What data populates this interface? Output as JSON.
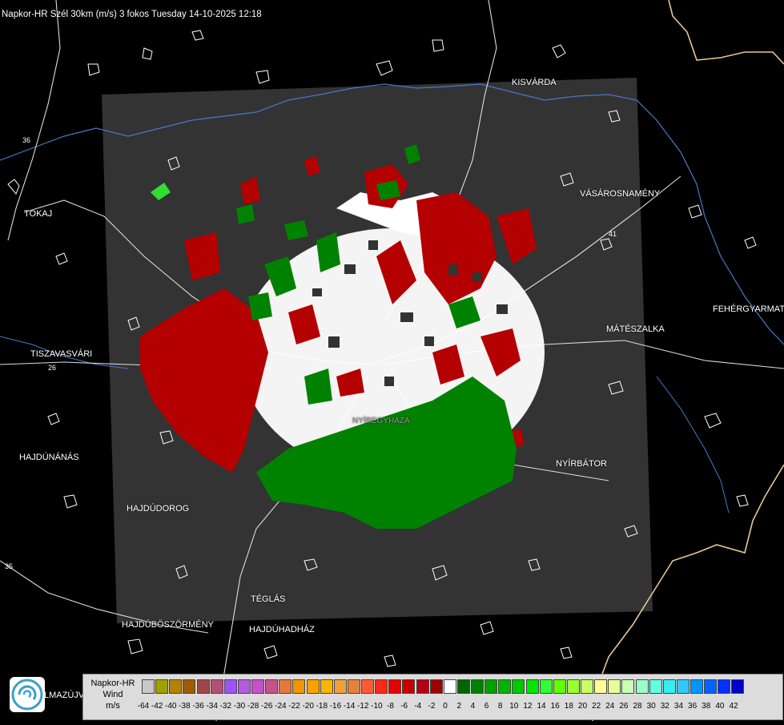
{
  "title": "Napkor-HR Szél 30km (m/s) 3 fokos Tuesday 14-10-2025 12:18",
  "towns": {
    "kisvarda": "KISVÁRDA",
    "vasarosnameny": "VÁSÁROSNAMÉNY",
    "tokaj": "TOKAJ",
    "fehergyarmat": "FEHÉRGYARMAT",
    "mateszalka": "MÁTÉSZALKA",
    "tiszavasvari": "TISZAVASVÁRI",
    "hajdunanas": "HAJDÚNÁNÁS",
    "nyirbator": "NYÍRBÁTOR",
    "hajdudorog": "HAJDÚDOROG",
    "teglas": "TÉGLÁS",
    "hajduboszormeny": "HAJDÚBÖSZÖRMÉNY",
    "hajduhadhaz": "HAJDÚHADHÁZ",
    "nyiregyhaza": "NYÍREGYHÁZA",
    "balmazujvaros": "LMAZÚJVÁR"
  },
  "road_labels": {
    "r36": "36",
    "r35": "35",
    "r41": "41",
    "r26": "26"
  },
  "legend": {
    "product": "Napkor-HR",
    "quantity": "Wind",
    "unit": "m/s",
    "swatches": [
      "#c8c8c8",
      "#a0a000",
      "#b48200",
      "#a05a00",
      "#a04646",
      "#b45078",
      "#a050ff",
      "#b45adc",
      "#c850c8",
      "#c8508c",
      "#e6783c",
      "#f09600",
      "#ffa000",
      "#ffb400",
      "#f0a03c",
      "#e6823c",
      "#ff5a32",
      "#ff2814",
      "#e60000",
      "#c80000",
      "#b40014",
      "#a00000",
      "#ffffff",
      "#006400",
      "#008200",
      "#00a000",
      "#00b400",
      "#00c800",
      "#00e600",
      "#32ff32",
      "#64ff00",
      "#96ff32",
      "#c8ff64",
      "#ffff96",
      "#e6ff96",
      "#c8ffb4",
      "#96ffc8",
      "#64ffdc",
      "#32f0f0",
      "#32c8ff",
      "#0096ff",
      "#0064ff",
      "#0032ff",
      "#0000c8"
    ],
    "ticks": [
      "-64",
      "-42",
      "-40",
      "-38",
      "-36",
      "-34",
      "-32",
      "-30",
      "-28",
      "-26",
      "-24",
      "-22",
      "-20",
      "-18",
      "-16",
      "-14",
      "-12",
      "-10",
      "-8",
      "-6",
      "-4",
      "-2",
      "0",
      "2",
      "4",
      "6",
      "8",
      "10",
      "12",
      "14",
      "16",
      "18",
      "20",
      "22",
      "24",
      "26",
      "28",
      "30",
      "32",
      "34",
      "36",
      "38",
      "40",
      "42"
    ]
  },
  "colors": {
    "outbound": "#b40000",
    "inbound": "#008200",
    "zero": "#ffffff",
    "radar_area": "#333333",
    "border": "#e6c896",
    "rivers": "#4a78c8"
  }
}
